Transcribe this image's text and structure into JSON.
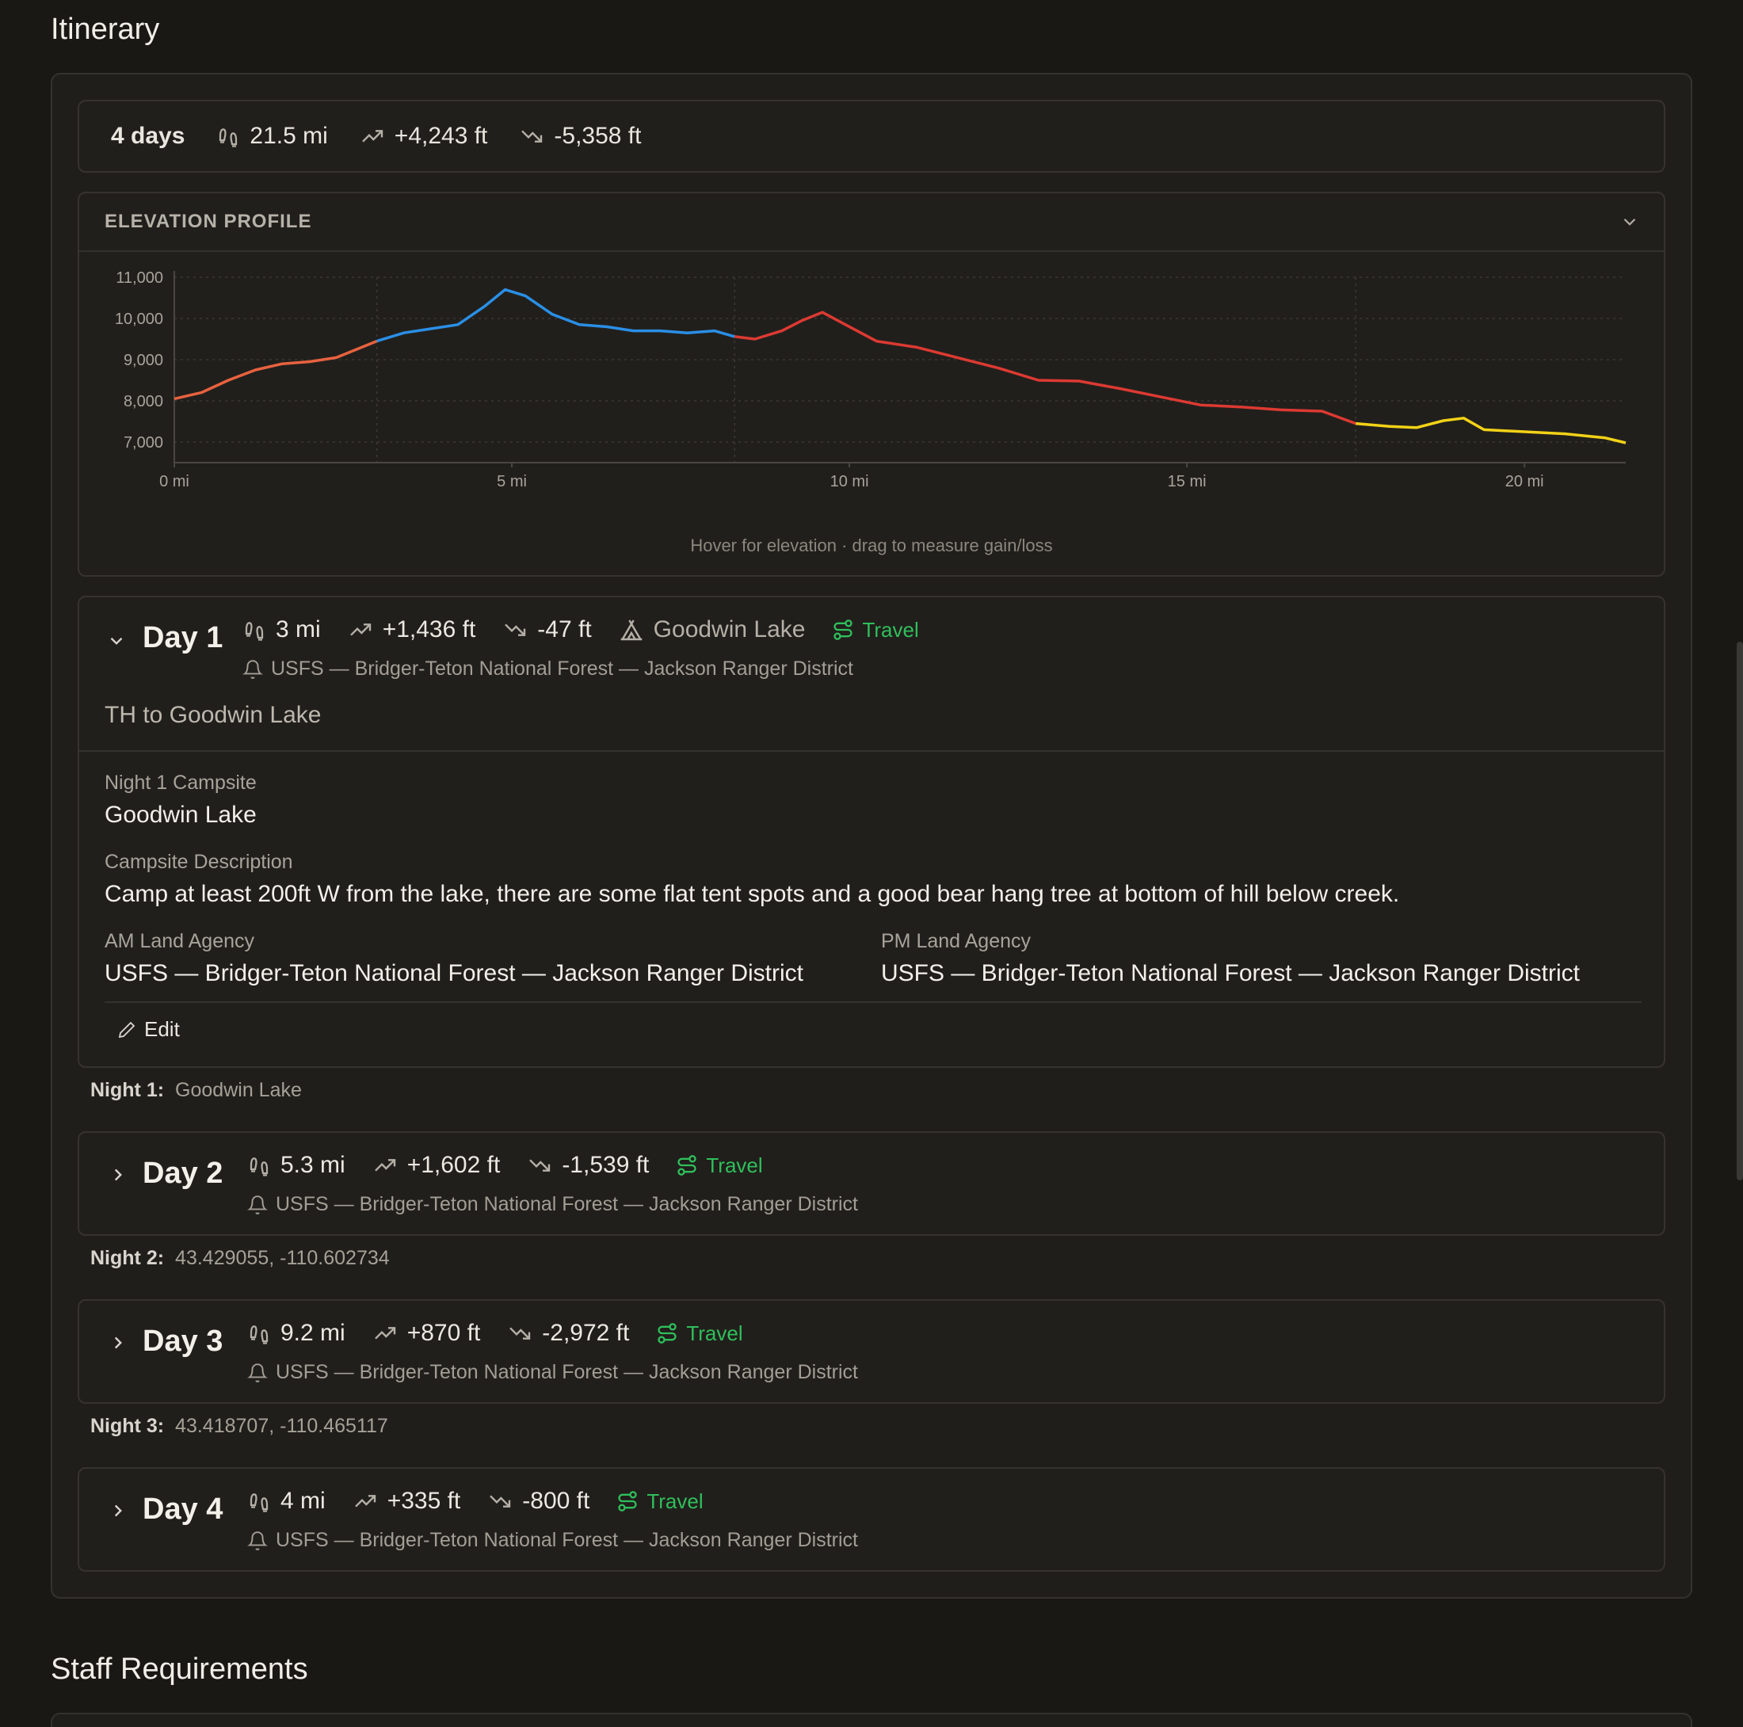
{
  "itinerary_title": "Itinerary",
  "staff_title": "Staff Requirements",
  "summary": {
    "days": "4 days",
    "distance": "21.5 mi",
    "gain": "+4,243 ft",
    "loss": "-5,358 ft"
  },
  "elevation": {
    "title": "ELEVATION PROFILE",
    "hint": "Hover for elevation · drag to measure gain/loss"
  },
  "chart_data": {
    "type": "line",
    "xlabel": "",
    "ylabel": "",
    "x_unit": "mi",
    "xlim": [
      0,
      21.5
    ],
    "ylim": [
      6500,
      11000
    ],
    "y_ticks": [
      "11,000",
      "10,000",
      "9,000",
      "8,000",
      "7,000"
    ],
    "x_ticks": [
      "0 mi",
      "5 mi",
      "10 mi",
      "15 mi",
      "20 mi"
    ],
    "grid": true,
    "segments": [
      {
        "day": 1,
        "color": "#e8623f",
        "points": [
          [
            0,
            8050
          ],
          [
            0.4,
            8200
          ],
          [
            0.8,
            8500
          ],
          [
            1.2,
            8750
          ],
          [
            1.6,
            8900
          ],
          [
            2.0,
            8950
          ],
          [
            2.4,
            9050
          ],
          [
            2.7,
            9250
          ],
          [
            3.0,
            9450
          ]
        ]
      },
      {
        "day": 2,
        "color": "#2a8fe6",
        "points": [
          [
            3.0,
            9450
          ],
          [
            3.4,
            9650
          ],
          [
            3.8,
            9750
          ],
          [
            4.2,
            9850
          ],
          [
            4.6,
            10300
          ],
          [
            4.9,
            10700
          ],
          [
            5.2,
            10550
          ],
          [
            5.6,
            10100
          ],
          [
            6.0,
            9850
          ],
          [
            6.4,
            9800
          ],
          [
            6.8,
            9700
          ],
          [
            7.2,
            9700
          ],
          [
            7.6,
            9650
          ],
          [
            8.0,
            9700
          ],
          [
            8.3,
            9560
          ]
        ]
      },
      {
        "day": 3,
        "color": "#dc3a32",
        "points": [
          [
            8.3,
            9560
          ],
          [
            8.6,
            9500
          ],
          [
            9.0,
            9700
          ],
          [
            9.3,
            9950
          ],
          [
            9.6,
            10150
          ],
          [
            10.0,
            9800
          ],
          [
            10.4,
            9450
          ],
          [
            11.0,
            9300
          ],
          [
            11.6,
            9050
          ],
          [
            12.2,
            8800
          ],
          [
            12.8,
            8500
          ],
          [
            13.4,
            8480
          ],
          [
            14.0,
            8300
          ],
          [
            14.6,
            8100
          ],
          [
            15.2,
            7900
          ],
          [
            15.8,
            7850
          ],
          [
            16.4,
            7780
          ],
          [
            17.0,
            7750
          ],
          [
            17.5,
            7450
          ]
        ]
      },
      {
        "day": 4,
        "color": "#f2d217",
        "points": [
          [
            17.5,
            7450
          ],
          [
            18.0,
            7380
          ],
          [
            18.4,
            7350
          ],
          [
            18.8,
            7520
          ],
          [
            19.1,
            7580
          ],
          [
            19.4,
            7300
          ],
          [
            20.0,
            7250
          ],
          [
            20.6,
            7200
          ],
          [
            21.2,
            7100
          ],
          [
            21.5,
            6980
          ]
        ]
      }
    ],
    "day_markers_mi": [
      3.0,
      8.3,
      17.5
    ]
  },
  "days": [
    {
      "title": "Day 1",
      "distance": "3 mi",
      "gain": "+1,436 ft",
      "loss": "-47 ft",
      "camp": "Goodwin Lake",
      "travel": "Travel",
      "agency": "USFS — Bridger-Teton National Forest — Jackson Ranger District",
      "subtitle": "TH to Goodwin Lake",
      "night_label": "Night 1 Campsite",
      "night_value": "Goodwin Lake",
      "desc_label": "Campsite Description",
      "desc_value": "Camp at least 200ft W from the lake, there are some flat tent spots and a good bear hang tree at bottom of hill below creek.",
      "am_label": "AM Land Agency",
      "am_value": "USFS — Bridger-Teton National Forest — Jackson Ranger District",
      "pm_label": "PM Land Agency",
      "pm_value": "USFS — Bridger-Teton National Forest — Jackson Ranger District",
      "edit_label": "Edit",
      "night_footer_label": "Night 1:",
      "night_footer_value": "Goodwin Lake"
    },
    {
      "title": "Day 2",
      "distance": "5.3 mi",
      "gain": "+1,602 ft",
      "loss": "-1,539 ft",
      "travel": "Travel",
      "agency": "USFS — Bridger-Teton National Forest — Jackson Ranger District",
      "night_footer_label": "Night 2:",
      "night_footer_value": "43.429055, -110.602734"
    },
    {
      "title": "Day 3",
      "distance": "9.2 mi",
      "gain": "+870 ft",
      "loss": "-2,972 ft",
      "travel": "Travel",
      "agency": "USFS — Bridger-Teton National Forest — Jackson Ranger District",
      "night_footer_label": "Night 3:",
      "night_footer_value": "43.418707, -110.465117"
    },
    {
      "title": "Day 4",
      "distance": "4 mi",
      "gain": "+335 ft",
      "loss": "-800 ft",
      "travel": "Travel",
      "agency": "USFS — Bridger-Teton National Forest — Jackson Ranger District"
    }
  ]
}
